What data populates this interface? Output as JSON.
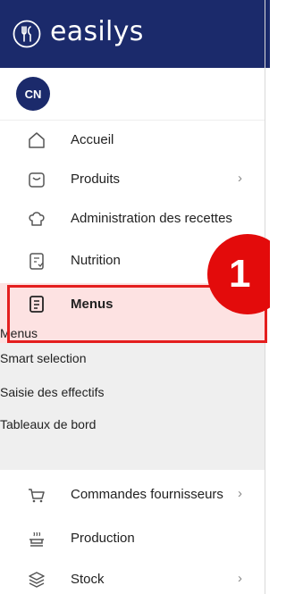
{
  "brand": {
    "name": "easilys"
  },
  "user": {
    "initials": "CN"
  },
  "menu": {
    "accueil": "Accueil",
    "produits": "Produits",
    "recettes": "Administration des recettes",
    "nutrition": "Nutrition",
    "menus": "Menus",
    "commandes": "Commandes fournisseurs",
    "production": "Production",
    "stock": "Stock"
  },
  "submenu": {
    "menus": "Menus",
    "smart": "Smart selection",
    "effectifs": "Saisie des effectifs",
    "tableaux": "Tableaux de bord"
  },
  "callout": {
    "number": "1"
  },
  "colors": {
    "brand": "#1b2a6b",
    "highlight": "#e41e1e",
    "active_bg": "#fde2e2",
    "badge": "#e30b0b"
  }
}
